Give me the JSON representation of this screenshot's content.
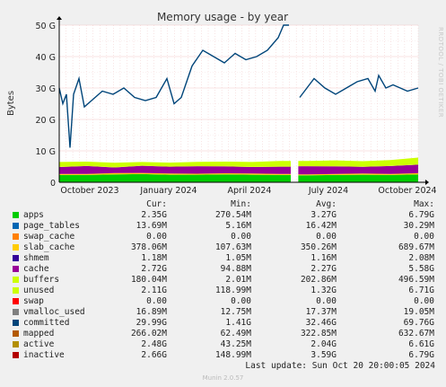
{
  "chart_data": {
    "type": "area",
    "title": "Memory usage - by year",
    "ylabel": "Bytes",
    "ylim": [
      0,
      50
    ],
    "y_unit": "G",
    "y_ticks": [
      "0",
      "10 G",
      "20 G",
      "30 G",
      "40 G",
      "50 G"
    ],
    "x_ticks": [
      "October 2023",
      "January 2024",
      "April 2024",
      "July 2024",
      "October 2024"
    ],
    "grid": true,
    "series": [
      {
        "name": "apps",
        "color": "#00cc00",
        "values": [
          2.3,
          2.3,
          2.5,
          2.6,
          2.4,
          2.4,
          2.5,
          2.4,
          2.3,
          2.2,
          2.3,
          2.4,
          2.3,
          2.5
        ]
      },
      {
        "name": "page_tables",
        "color": "#0066b3",
        "values": [
          0.01,
          0.01,
          0.01,
          0.01,
          0.01,
          0.01,
          0.01,
          0.01,
          0.01,
          0.01,
          0.01,
          0.01,
          0.01,
          0.01
        ]
      },
      {
        "name": "swap_cache",
        "color": "#ff8000",
        "values": [
          0,
          0,
          0,
          0,
          0,
          0,
          0,
          0,
          0,
          0,
          0,
          0,
          0,
          0
        ]
      },
      {
        "name": "slab_cache",
        "color": "#ffcc00",
        "values": [
          0.35,
          0.35,
          0.4,
          0.35,
          0.35,
          0.3,
          0.35,
          0.35,
          0.35,
          0.3,
          0.35,
          0.4,
          0.35,
          0.38
        ]
      },
      {
        "name": "shmem",
        "color": "#330099",
        "values": [
          0.001,
          0.001,
          0.001,
          0.001,
          0.001,
          0.001,
          0.001,
          0.001,
          0.001,
          0.001,
          0.001,
          0.001,
          0.001,
          0.001
        ]
      },
      {
        "name": "cache",
        "color": "#990099",
        "values": [
          2.2,
          2.5,
          1.8,
          2.3,
          2.2,
          2.4,
          2.2,
          2.1,
          2.3,
          2.6,
          2.4,
          2.1,
          2.5,
          2.7
        ]
      },
      {
        "name": "buffers",
        "color": "#ccff00",
        "values": [
          0.2,
          0.2,
          0.2,
          0.2,
          0.2,
          0.2,
          0.2,
          0.2,
          0.2,
          0.2,
          0.2,
          0.2,
          0.2,
          0.18
        ]
      },
      {
        "name": "unused",
        "color": "#ccff00",
        "values": [
          1.4,
          1.2,
          1.3,
          1.0,
          1.1,
          1.2,
          1.3,
          1.4,
          1.6,
          1.5,
          1.7,
          1.6,
          1.7,
          2.1
        ]
      }
    ],
    "committed": {
      "name": "committed",
      "color": "#00457a",
      "points": [
        [
          0,
          30
        ],
        [
          0.01,
          25
        ],
        [
          0.02,
          28
        ],
        [
          0.03,
          11
        ],
        [
          0.04,
          28
        ],
        [
          0.055,
          33
        ],
        [
          0.07,
          24
        ],
        [
          0.09,
          26
        ],
        [
          0.12,
          29
        ],
        [
          0.15,
          28
        ],
        [
          0.18,
          30
        ],
        [
          0.21,
          27
        ],
        [
          0.24,
          26
        ],
        [
          0.27,
          27
        ],
        [
          0.3,
          33
        ],
        [
          0.32,
          25
        ],
        [
          0.34,
          27
        ],
        [
          0.37,
          37
        ],
        [
          0.4,
          42
        ],
        [
          0.43,
          40
        ],
        [
          0.46,
          38
        ],
        [
          0.49,
          41
        ],
        [
          0.52,
          39
        ],
        [
          0.55,
          40
        ],
        [
          0.58,
          42
        ],
        [
          0.61,
          46
        ],
        [
          0.625,
          50
        ],
        [
          0.64,
          50
        ],
        [
          0.665,
          null
        ],
        [
          0.67,
          27
        ],
        [
          0.69,
          30
        ],
        [
          0.71,
          33
        ],
        [
          0.74,
          30
        ],
        [
          0.77,
          28
        ],
        [
          0.8,
          30
        ],
        [
          0.83,
          32
        ],
        [
          0.86,
          33
        ],
        [
          0.88,
          29
        ],
        [
          0.89,
          34
        ],
        [
          0.91,
          30
        ],
        [
          0.93,
          31
        ],
        [
          0.95,
          30
        ],
        [
          0.97,
          29
        ],
        [
          1.0,
          30
        ]
      ]
    },
    "gap_fraction_start": 0.645,
    "gap_fraction_end": 0.666
  },
  "legend": {
    "headers": {
      "cur": "Cur:",
      "min": "Min:",
      "avg": "Avg:",
      "max": "Max:"
    },
    "rows": [
      {
        "name": "apps",
        "color": "#00cc00",
        "cur": "2.35G",
        "min": "270.54M",
        "avg": "3.27G",
        "max": "6.79G"
      },
      {
        "name": "page_tables",
        "color": "#0066b3",
        "cur": "13.69M",
        "min": "5.16M",
        "avg": "16.42M",
        "max": "30.29M"
      },
      {
        "name": "swap_cache",
        "color": "#ff8000",
        "cur": "0.00",
        "min": "0.00",
        "avg": "0.00",
        "max": "0.00"
      },
      {
        "name": "slab_cache",
        "color": "#ffcc00",
        "cur": "378.06M",
        "min": "107.63M",
        "avg": "350.26M",
        "max": "689.67M"
      },
      {
        "name": "shmem",
        "color": "#330099",
        "cur": "1.18M",
        "min": "1.05M",
        "avg": "1.16M",
        "max": "2.08M"
      },
      {
        "name": "cache",
        "color": "#990099",
        "cur": "2.72G",
        "min": "94.88M",
        "avg": "2.27G",
        "max": "5.58G"
      },
      {
        "name": "buffers",
        "color": "#ccff00",
        "cur": "180.04M",
        "min": "2.01M",
        "avg": "202.86M",
        "max": "496.59M"
      },
      {
        "name": "unused",
        "color": "#ccff00",
        "cur": "2.11G",
        "min": "118.99M",
        "avg": "1.32G",
        "max": "6.71G"
      },
      {
        "name": "swap",
        "color": "#ff0000",
        "cur": "0.00",
        "min": "0.00",
        "avg": "0.00",
        "max": "0.00"
      },
      {
        "name": "vmalloc_used",
        "color": "#808080",
        "cur": "16.89M",
        "min": "12.75M",
        "avg": "17.37M",
        "max": "19.05M"
      },
      {
        "name": "committed",
        "color": "#00457a",
        "cur": "29.99G",
        "min": "1.41G",
        "avg": "32.46G",
        "max": "69.76G"
      },
      {
        "name": "mapped",
        "color": "#b35a00",
        "cur": "266.02M",
        "min": "62.49M",
        "avg": "322.85M",
        "max": "632.67M"
      },
      {
        "name": "active",
        "color": "#b38f00",
        "cur": "2.48G",
        "min": "43.25M",
        "avg": "2.04G",
        "max": "6.61G"
      },
      {
        "name": "inactive",
        "color": "#b30000",
        "cur": "2.66G",
        "min": "148.99M",
        "avg": "3.59G",
        "max": "6.79G"
      }
    ]
  },
  "footer": {
    "last_update": "Last update: Sun Oct 20 20:00:05 2024",
    "munin": "Munin 2.0.57",
    "watermark": "RRDTOOL / TOBI OETIKER"
  }
}
